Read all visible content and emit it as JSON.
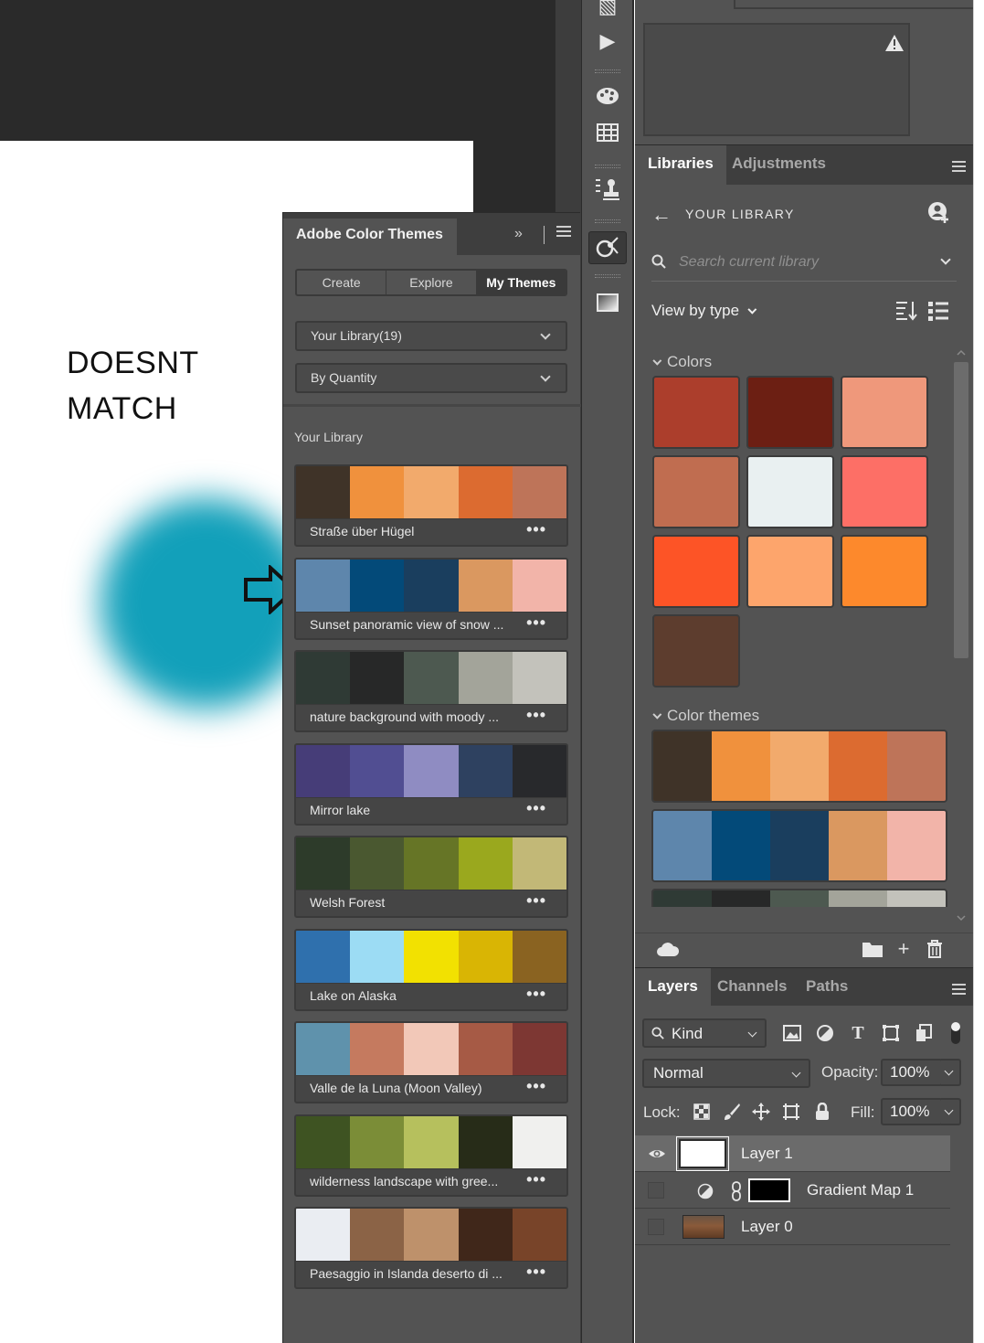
{
  "annotation": {
    "line1": "DOESNT",
    "line2": "MATCH"
  },
  "color_themes_panel": {
    "title": "Adobe Color Themes",
    "expand_icon": "double-chevron-right-icon",
    "tabs": [
      {
        "label": "Create",
        "active": false
      },
      {
        "label": "Explore",
        "active": false
      },
      {
        "label": "My Themes",
        "active": true
      }
    ],
    "library_select": "Your Library(19)",
    "sort_select": "By Quantity",
    "section_label": "Your Library",
    "themes": [
      {
        "name": "Straße über Hügel",
        "colors": [
          "#3f3328",
          "#f0913d",
          "#f2aa6c",
          "#dc6b30",
          "#be7459"
        ]
      },
      {
        "name": "Sunset panoramic view of snow ...",
        "colors": [
          "#5e86ac",
          "#034a79",
          "#1a3e5e",
          "#da9860",
          "#f2b4a9"
        ]
      },
      {
        "name": "nature background with moody ...",
        "colors": [
          "#2f3a35",
          "#272828",
          "#4d5950",
          "#a3a49a",
          "#c3c2bb"
        ]
      },
      {
        "name": "Mirror lake",
        "colors": [
          "#463d78",
          "#514e92",
          "#8f8cc2",
          "#2e4160",
          "#28292c"
        ]
      },
      {
        "name": "Welsh Forest",
        "colors": [
          "#2d3b2a",
          "#4a5830",
          "#667526",
          "#9aa81e",
          "#c2b877"
        ]
      },
      {
        "name": "Lake on Alaska",
        "colors": [
          "#2f70ad",
          "#9cdcf4",
          "#f2e101",
          "#d9b504",
          "#8a6321"
        ]
      },
      {
        "name": "Valle de la Luna (Moon Valley)",
        "colors": [
          "#5f92ac",
          "#c57a5f",
          "#f2c8b8",
          "#a65a45",
          "#7d3733"
        ]
      },
      {
        "name": "wilderness landscape with gree...",
        "colors": [
          "#3e5322",
          "#7b8d37",
          "#b6c05d",
          "#272c18",
          "#f0f0ee"
        ]
      },
      {
        "name": "Paesaggio in Islanda deserto di ...",
        "colors": [
          "#eaedf2",
          "#8b6346",
          "#be916b",
          "#40271a",
          "#784429"
        ]
      }
    ]
  },
  "toolbar": {
    "icons": [
      "brush-settings-icon",
      "play-icon",
      "palette-icon",
      "grid-icon",
      "stamp-icon",
      "adobe-color-icon",
      "gradient-icon"
    ]
  },
  "libraries_panel": {
    "tabs": [
      {
        "label": "Libraries",
        "active": true
      },
      {
        "label": "Adjustments",
        "active": false
      }
    ],
    "back_icon": "arrow-left-icon",
    "library_name": "YOUR LIBRARY",
    "search_placeholder": "Search current library",
    "view_by": "View by type",
    "colors_section": "Colors",
    "colors": [
      "#ac3e2c",
      "#6c1f13",
      "#ef987b",
      "#c06d50",
      "#e9f0f1",
      "#fd6f66",
      "#fd5426",
      "#fda56c",
      "#fd892c",
      "#5d3d2e"
    ],
    "themes_section": "Color themes",
    "themes": [
      [
        "#3f3328",
        "#f0913d",
        "#f2aa6c",
        "#dc6b30",
        "#be7459"
      ],
      [
        "#5e86ac",
        "#034a79",
        "#1a3e5e",
        "#da9860",
        "#f2b4a9"
      ],
      [
        "#2f3a35",
        "#272828",
        "#4d5950",
        "#a3a49a",
        "#c3c2bb"
      ]
    ]
  },
  "layers_panel": {
    "tabs": [
      {
        "label": "Layers",
        "active": true
      },
      {
        "label": "Channels",
        "active": false
      },
      {
        "label": "Paths",
        "active": false
      }
    ],
    "kind": "Kind",
    "blend_mode": "Normal",
    "opacity_label": "Opacity:",
    "opacity": "100%",
    "lock_label": "Lock:",
    "fill_label": "Fill:",
    "fill": "100%",
    "layers": [
      {
        "name": "Layer 1",
        "visible": true,
        "selected": true
      },
      {
        "name": "Gradient Map 1",
        "visible": false,
        "selected": false
      },
      {
        "name": "Layer 0",
        "visible": false,
        "selected": false
      }
    ]
  },
  "colors": {
    "accent_teal": "#12a0ba",
    "panel_bg": "#535353",
    "panel_dark": "#3e3e3e"
  }
}
